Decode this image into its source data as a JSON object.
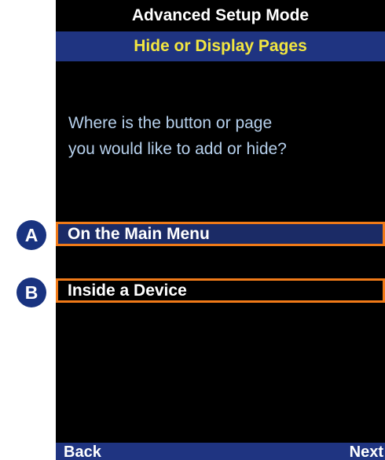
{
  "header": {
    "title": "Advanced Setup Mode",
    "subtitle": "Hide or Display Pages"
  },
  "prompt": {
    "line1": "Where is the button or page",
    "line2": "you would like to add or hide?"
  },
  "options": [
    {
      "badge": "A",
      "label": "On the Main Menu",
      "selected": true
    },
    {
      "badge": "B",
      "label": "Inside a Device",
      "selected": false
    }
  ],
  "softkeys": {
    "left": "Back",
    "right": "Next"
  },
  "colors": {
    "title_text": "#ffffff",
    "subtitle_bg": "#1f3481",
    "subtitle_text": "#f2e640",
    "prompt_text": "#b6d0ec",
    "selected_bg": "#1b2b66",
    "callout_border": "#f07a18",
    "badge_bg": "#193380"
  }
}
